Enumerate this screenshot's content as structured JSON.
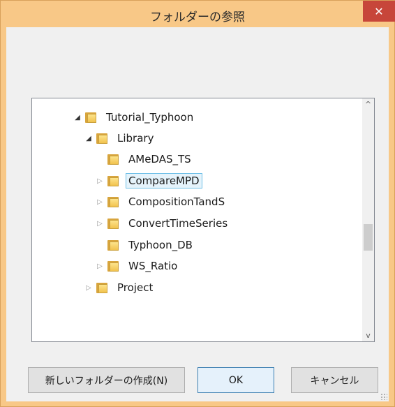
{
  "window": {
    "title": "フォルダーの参照",
    "close_symbol": "✕"
  },
  "tree": {
    "items": [
      {
        "label": "Tutorial_Typhoon",
        "state": "expanded"
      },
      {
        "label": "Library",
        "state": "expanded"
      },
      {
        "label": "AMeDAS_TS",
        "state": "none"
      },
      {
        "label": "CompareMPD",
        "state": "collapsed",
        "selected": true
      },
      {
        "label": "CompositionTandS",
        "state": "collapsed"
      },
      {
        "label": "ConvertTimeSeries",
        "state": "collapsed"
      },
      {
        "label": "Typhoon_DB",
        "state": "none"
      },
      {
        "label": "WS_Ratio",
        "state": "collapsed"
      },
      {
        "label": "Project",
        "state": "collapsed"
      }
    ],
    "expanded_glyph": "◢",
    "collapsed_glyph": "▷"
  },
  "scrollbar": {
    "up_symbol": "^",
    "down_symbol": "v"
  },
  "buttons": {
    "new_folder": "新しいフォルダーの作成(N)",
    "ok": "OK",
    "cancel": "キャンセル"
  },
  "colors": {
    "titlebar": "#f8c887",
    "close": "#c7463a",
    "selection_border": "#70c0e7",
    "selection_fill": "#e5f3fb"
  }
}
